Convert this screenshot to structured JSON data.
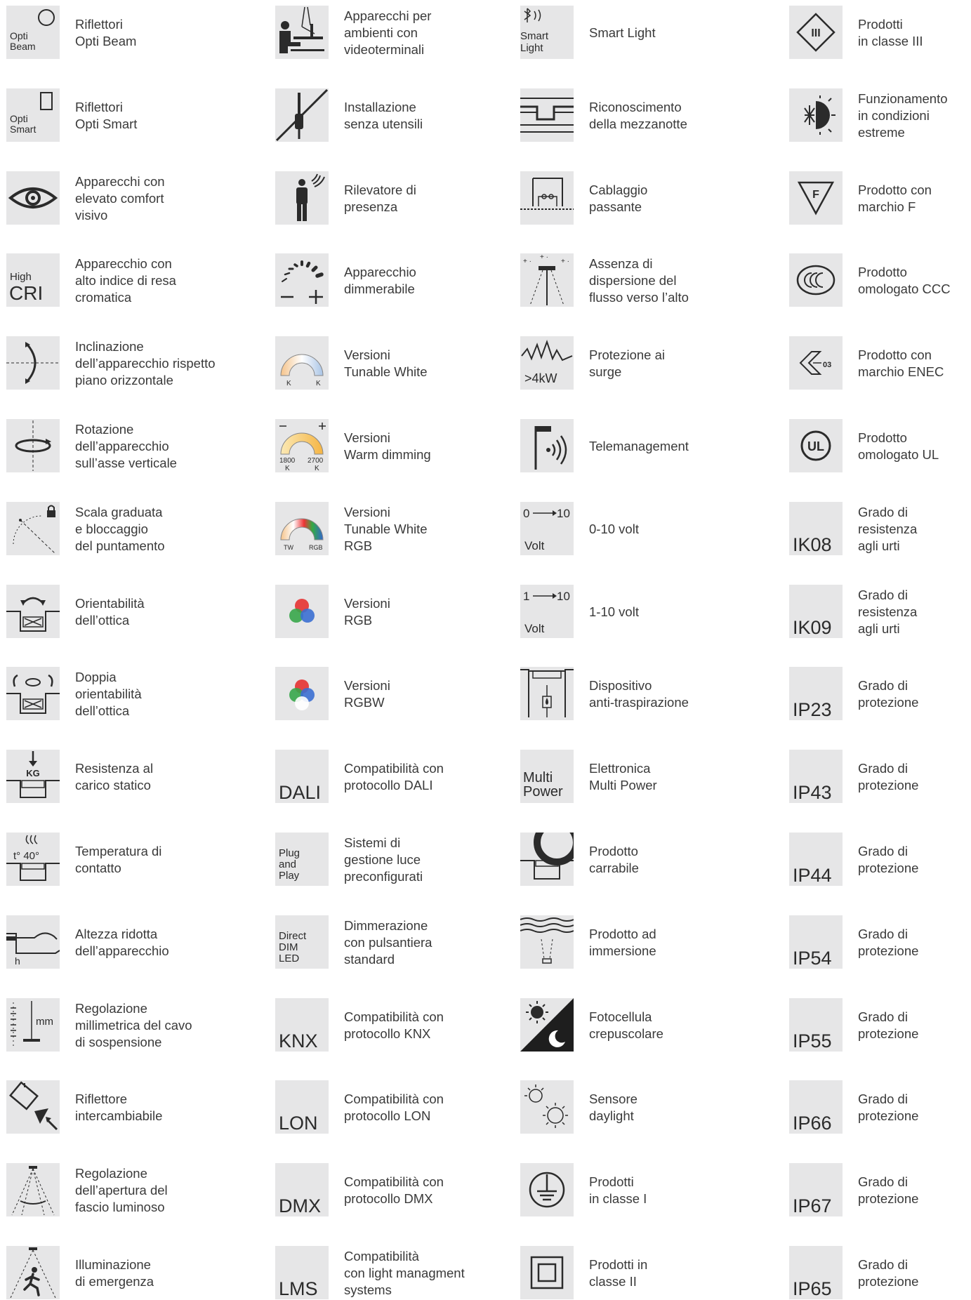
{
  "columns": [
    {
      "items": [
        {
          "icon": "opti-beam-icon",
          "icon_text": [
            "Opti",
            "Beam"
          ],
          "label": [
            "Riflettori",
            "Opti Beam"
          ]
        },
        {
          "icon": "opti-smart-icon",
          "icon_text": [
            "Opti",
            "Smart"
          ],
          "label": [
            "Riflettori",
            "Opti Smart"
          ]
        },
        {
          "icon": "eye-icon",
          "label": [
            "Apparecchi con",
            "elevato comfort",
            "visivo"
          ]
        },
        {
          "icon": "high-cri-icon",
          "icon_text": [
            "High",
            "CRI"
          ],
          "label": [
            "Apparecchio con",
            "alto indice di resa",
            "cromatica"
          ]
        },
        {
          "icon": "tilt-icon",
          "label": [
            "Inclinazione",
            "dell’apparecchio rispetto",
            "piano orizzontale"
          ]
        },
        {
          "icon": "rotation-icon",
          "label": [
            "Rotazione",
            "dell’apparecchio",
            "sull’asse verticale"
          ]
        },
        {
          "icon": "graduated-scale-lock-icon",
          "label": [
            "Scala graduata",
            "e bloccaggio",
            "del puntamento"
          ]
        },
        {
          "icon": "optic-orientation-icon",
          "label": [
            "Orientabilità",
            "dell’ottica"
          ]
        },
        {
          "icon": "double-orientation-icon",
          "label": [
            "Doppia",
            "orientabilità",
            "dell’ottica"
          ]
        },
        {
          "icon": "static-load-icon",
          "icon_text": [
            "KG"
          ],
          "label": [
            "Resistenza al",
            "carico statico"
          ]
        },
        {
          "icon": "contact-temperature-icon",
          "icon_text": [
            "t° 40°"
          ],
          "label": [
            "Temperatura di",
            "contatto"
          ]
        },
        {
          "icon": "reduced-height-icon",
          "icon_text": [
            "h"
          ],
          "label": [
            "Altezza ridotta",
            "dell’apparecchio"
          ]
        },
        {
          "icon": "cable-adjustment-icon",
          "icon_text": [
            "mm"
          ],
          "label": [
            "Regolazione",
            "millimetrica del cavo",
            "di sospensione"
          ]
        },
        {
          "icon": "interchangeable-reflector-icon",
          "label": [
            "Riflettore",
            "intercambiabile"
          ]
        },
        {
          "icon": "beam-aperture-icon",
          "label": [
            "Regolazione",
            "dell’apertura del",
            "fascio luminoso"
          ]
        },
        {
          "icon": "emergency-icon",
          "label": [
            "Illuminazione",
            "di emergenza"
          ]
        }
      ]
    },
    {
      "items": [
        {
          "icon": "vdt-workstation-icon",
          "label": [
            "Apparecchi per",
            "ambienti con",
            "videoterminali"
          ]
        },
        {
          "icon": "tool-free-icon",
          "label": [
            "Installazione",
            "senza utensili"
          ]
        },
        {
          "icon": "presence-detector-icon",
          "label": [
            "Rilevatore di",
            "presenza"
          ]
        },
        {
          "icon": "dimmable-icon",
          "label": [
            "Apparecchio",
            "dimmerabile"
          ]
        },
        {
          "icon": "tunable-white-icon",
          "icon_text": [
            "K",
            "K"
          ],
          "label": [
            "Versioni",
            "Tunable White"
          ]
        },
        {
          "icon": "warm-dimming-icon",
          "icon_text": [
            "1800",
            "K",
            "2700",
            "K"
          ],
          "label": [
            "Versioni",
            "Warm dimming"
          ]
        },
        {
          "icon": "tunable-white-rgb-icon",
          "icon_text": [
            "TW",
            "RGB"
          ],
          "label": [
            "Versioni",
            "Tunable White",
            "RGB"
          ]
        },
        {
          "icon": "rgb-icon",
          "label": [
            "Versioni",
            "RGB"
          ]
        },
        {
          "icon": "rgbw-icon",
          "label": [
            "Versioni",
            "RGBW"
          ]
        },
        {
          "icon": "dali-icon",
          "icon_text": [
            "DALI"
          ],
          "label": [
            "Compatibilità con",
            "protocollo DALI"
          ]
        },
        {
          "icon": "plug-and-play-icon",
          "icon_text": [
            "Plug",
            "and",
            "Play"
          ],
          "label": [
            "Sistemi di",
            "gestione luce",
            "preconfigurati"
          ]
        },
        {
          "icon": "direct-dim-led-icon",
          "icon_text": [
            "Direct",
            "DIM",
            "LED"
          ],
          "label": [
            "Dimmerazione",
            "con pulsantiera",
            "standard"
          ]
        },
        {
          "icon": "knx-icon",
          "icon_text": [
            "KNX"
          ],
          "label": [
            "Compatibilità con",
            "protocollo KNX"
          ]
        },
        {
          "icon": "lon-icon",
          "icon_text": [
            "LON"
          ],
          "label": [
            "Compatibilità con",
            "protocollo LON"
          ]
        },
        {
          "icon": "dmx-icon",
          "icon_text": [
            "DMX"
          ],
          "label": [
            "Compatibilità con",
            "protocollo DMX"
          ]
        },
        {
          "icon": "lms-icon",
          "icon_text": [
            "LMS"
          ],
          "label": [
            "Compatibilità",
            "con light managment",
            "systems"
          ]
        }
      ]
    },
    {
      "items": [
        {
          "icon": "smart-light-icon",
          "icon_text": [
            "Smart",
            "Light"
          ],
          "label": [
            "Smart Light"
          ]
        },
        {
          "icon": "midnight-recognition-icon",
          "label": [
            "Riconoscimento",
            "della mezzanotte"
          ]
        },
        {
          "icon": "through-wiring-icon",
          "label": [
            "Cablaggio",
            "passante"
          ]
        },
        {
          "icon": "no-upward-light-icon",
          "label": [
            "Assenza di",
            "dispersione del",
            "flusso verso l’alto"
          ]
        },
        {
          "icon": "surge-protection-icon",
          "icon_text": [
            ">4kW"
          ],
          "label": [
            "Protezione ai",
            "surge"
          ]
        },
        {
          "icon": "telemanagement-icon",
          "label": [
            "Telemanagement"
          ]
        },
        {
          "icon": "0-10-volt-icon",
          "icon_text": [
            "0",
            "10",
            "Volt"
          ],
          "label": [
            "0-10 volt"
          ]
        },
        {
          "icon": "1-10-volt-icon",
          "icon_text": [
            "1",
            "10",
            "Volt"
          ],
          "label": [
            "1-10 volt"
          ]
        },
        {
          "icon": "anti-condensation-icon",
          "label": [
            "Dispositivo",
            "anti-traspirazione"
          ]
        },
        {
          "icon": "multi-power-icon",
          "icon_text": [
            "Multi",
            "Power"
          ],
          "label": [
            "Elettronica",
            "Multi Power"
          ]
        },
        {
          "icon": "drive-over-icon",
          "label": [
            "Prodotto",
            "carrabile"
          ]
        },
        {
          "icon": "immersion-icon",
          "label": [
            "Prodotto ad",
            "immersione"
          ]
        },
        {
          "icon": "twilight-photocell-icon",
          "label": [
            "Fotocellula",
            "crepuscolare"
          ]
        },
        {
          "icon": "daylight-sensor-icon",
          "label": [
            "Sensore",
            "daylight"
          ]
        },
        {
          "icon": "class-i-icon",
          "label": [
            "Prodotti",
            "in classe I"
          ]
        },
        {
          "icon": "class-ii-icon",
          "label": [
            "Prodotti in",
            "classe II"
          ]
        }
      ]
    },
    {
      "items": [
        {
          "icon": "class-iii-icon",
          "icon_text": [
            "III"
          ],
          "label": [
            "Prodotti",
            "in classe III"
          ]
        },
        {
          "icon": "extreme-conditions-icon",
          "label": [
            "Funzionamento",
            "in condizioni",
            "estreme"
          ]
        },
        {
          "icon": "f-mark-icon",
          "icon_text": [
            "F"
          ],
          "label": [
            "Prodotto con",
            "marchio F"
          ]
        },
        {
          "icon": "ccc-icon",
          "label": [
            "Prodotto",
            "omologato CCC"
          ]
        },
        {
          "icon": "enec-icon",
          "icon_text": [
            "03"
          ],
          "label": [
            "Prodotto con",
            "marchio ENEC"
          ]
        },
        {
          "icon": "ul-icon",
          "icon_text": [
            "UL"
          ],
          "label": [
            "Prodotto",
            "omologato UL"
          ]
        },
        {
          "icon": "ik08-icon",
          "icon_text": [
            "IK08"
          ],
          "label": [
            "Grado di",
            "resistenza",
            "agli urti"
          ]
        },
        {
          "icon": "ik09-icon",
          "icon_text": [
            "IK09"
          ],
          "label": [
            "Grado di",
            "resistenza",
            "agli urti"
          ]
        },
        {
          "icon": "ip23-icon",
          "icon_text": [
            "IP23"
          ],
          "label": [
            "Grado di",
            "protezione"
          ]
        },
        {
          "icon": "ip43-icon",
          "icon_text": [
            "IP43"
          ],
          "label": [
            "Grado di",
            "protezione"
          ]
        },
        {
          "icon": "ip44-icon",
          "icon_text": [
            "IP44"
          ],
          "label": [
            "Grado di",
            "protezione"
          ]
        },
        {
          "icon": "ip54-icon",
          "icon_text": [
            "IP54"
          ],
          "label": [
            "Grado di",
            "protezione"
          ]
        },
        {
          "icon": "ip55-icon",
          "icon_text": [
            "IP55"
          ],
          "label": [
            "Grado di",
            "protezione"
          ]
        },
        {
          "icon": "ip66-icon",
          "icon_text": [
            "IP66"
          ],
          "label": [
            "Grado di",
            "protezione"
          ]
        },
        {
          "icon": "ip67-icon",
          "icon_text": [
            "IP67"
          ],
          "label": [
            "Grado di",
            "protezione"
          ]
        },
        {
          "icon": "ip65-icon",
          "icon_text": [
            "IP65"
          ],
          "label": [
            "Grado di",
            "protezione"
          ]
        }
      ]
    }
  ]
}
